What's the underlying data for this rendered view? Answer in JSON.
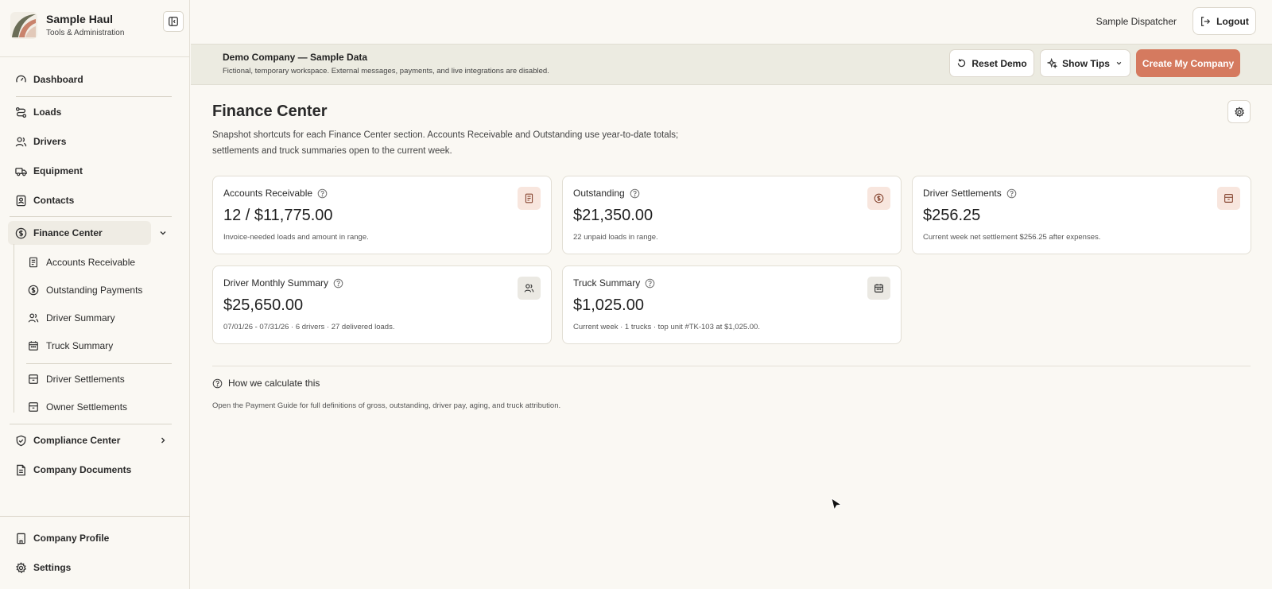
{
  "brand": {
    "name": "Sample Haul",
    "subtitle": "Tools & Administration"
  },
  "sidebar": {
    "items": [
      {
        "label": "Dashboard",
        "icon": "gauge-icon"
      },
      {
        "label": "Loads",
        "icon": "route-icon"
      },
      {
        "label": "Drivers",
        "icon": "users-icon"
      },
      {
        "label": "Equipment",
        "icon": "truck-icon"
      },
      {
        "label": "Contacts",
        "icon": "contact-icon"
      },
      {
        "label": "Finance Center",
        "icon": "dollar-circle-icon",
        "expanded": true
      },
      {
        "label": "Compliance Center",
        "icon": "shield-icon"
      },
      {
        "label": "Company Documents",
        "icon": "document-icon"
      }
    ],
    "finance_sub": [
      {
        "label": "Accounts Receivable",
        "icon": "receipt-icon"
      },
      {
        "label": "Outstanding Payments",
        "icon": "dollar-circle-icon"
      },
      {
        "label": "Driver Summary",
        "icon": "users-icon"
      },
      {
        "label": "Truck Summary",
        "icon": "calendar-icon"
      },
      {
        "label": "Driver Settlements",
        "icon": "archive-icon"
      },
      {
        "label": "Owner Settlements",
        "icon": "archive-icon"
      }
    ],
    "bottom": [
      {
        "label": "Company Profile",
        "icon": "building-icon"
      },
      {
        "label": "Settings",
        "icon": "gear-icon"
      }
    ]
  },
  "topbar": {
    "user": "Sample Dispatcher",
    "logout": "Logout"
  },
  "banner": {
    "title": "Demo Company — Sample Data",
    "description": "Fictional, temporary workspace. External messages, payments, and live integrations are disabled.",
    "reset": "Reset Demo",
    "tips": "Show Tips",
    "create": "Create My Company"
  },
  "page": {
    "title": "Finance Center",
    "description": "Snapshot shortcuts for each Finance Center section. Accounts Receivable and Outstanding use year-to-date totals; settlements and truck summaries open to the current week."
  },
  "cards": [
    {
      "title": "Accounts Receivable",
      "value": "12 / $11,775.00",
      "note": "Invoice-needed loads and amount in range.",
      "icon": "receipt-icon"
    },
    {
      "title": "Outstanding",
      "value": "$21,350.00",
      "note": "22 unpaid loads in range.",
      "icon": "dollar-circle-icon"
    },
    {
      "title": "Driver Settlements",
      "value": "$256.25",
      "note": "Current week net settlement $256.25 after expenses.",
      "icon": "archive-icon"
    },
    {
      "title": "Driver Monthly Summary",
      "value": "$25,650.00",
      "note": "07/01/26 - 07/31/26 · 6 drivers · 27 delivered loads.",
      "icon": "users-icon"
    },
    {
      "title": "Truck Summary",
      "value": "$1,025.00",
      "note": "Current week · 1 trucks · top unit #TK-103 at $1,025.00.",
      "icon": "calendar-icon"
    }
  ],
  "calc": {
    "heading": "How we calculate this",
    "note": "Open the Payment Guide for full definitions of gross, outstanding, driver pay, aging, and truck attribution."
  },
  "colors": {
    "accent": "#d57a5f",
    "background": "#faf8f3",
    "banner": "#ecebe1"
  }
}
